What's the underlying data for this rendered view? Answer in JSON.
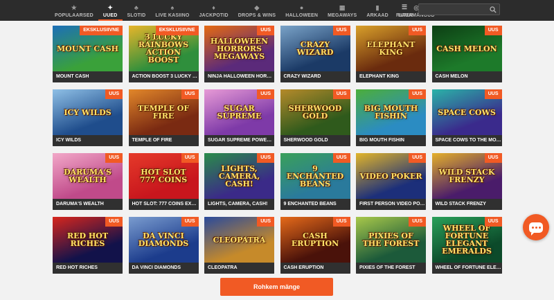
{
  "nav": {
    "items": [
      {
        "label": "POPULAARSED",
        "icon": "star-icon",
        "glyph": "★",
        "active": false
      },
      {
        "label": "UUED",
        "icon": "sparkle-icon",
        "glyph": "✦",
        "active": true
      },
      {
        "label": "SLOTID",
        "icon": "cherry-icon",
        "glyph": "♣",
        "active": false
      },
      {
        "label": "LIVE KASIINO",
        "icon": "live-dealer-icon",
        "glyph": "♠",
        "active": false
      },
      {
        "label": "JACKPOTID",
        "icon": "jackpot-icon",
        "glyph": "♦",
        "active": false
      },
      {
        "label": "DROPS & WINS",
        "icon": "drops-icon",
        "glyph": "◆",
        "active": false
      },
      {
        "label": "HALLOWEEN",
        "icon": "pumpkin-icon",
        "glyph": "●",
        "active": false
      },
      {
        "label": "MEGAWAYS",
        "icon": "megaways-icon",
        "glyph": "▦",
        "active": false
      },
      {
        "label": "ARKAAD",
        "icon": "arcade-icon",
        "glyph": "▮",
        "active": false
      },
      {
        "label": "LAUAMÄNGUD",
        "icon": "table-games-icon",
        "glyph": "◎",
        "active": false
      }
    ],
    "filter_label": "FILTER",
    "filter_icon": "filter-icon",
    "search_placeholder": "",
    "search_icon": "search-icon"
  },
  "games": [
    {
      "name": "MOUNT CASH",
      "badge": "EKSKLUSIIVNE",
      "art": "MOUNT CASH",
      "bg": "#3aa13a",
      "bg2": "#1c6fb8"
    },
    {
      "name": "ACTION BOOST 3 LUCKY RA...",
      "badge": "EKSKLUSIIVNE",
      "art": "3 LUCKY RAINBOWS ACTION BOOST",
      "bg": "#2f8f3c",
      "bg2": "#e7b52a"
    },
    {
      "name": "NINJA HALLOWEEN HORRO...",
      "badge": "UUS",
      "art": "HALLOWEEN HORRORS MEGAWAYS",
      "bg": "#5b2a7a",
      "bg2": "#e56a12"
    },
    {
      "name": "CRAZY WIZARD",
      "badge": "UUS",
      "art": "CRAZY WIZARD",
      "bg": "#1b3a66",
      "bg2": "#7aa3c8"
    },
    {
      "name": "ELEPHANT KING",
      "badge": "UUS",
      "art": "ELEPHANT KING",
      "bg": "#6a2b0e",
      "bg2": "#d9a02a"
    },
    {
      "name": "CASH MELON",
      "badge": "UUS",
      "art": "CASH MELON",
      "bg": "#1d7a2a",
      "bg2": "#0d3f14"
    },
    {
      "name": "ICY WILDS",
      "badge": "UUS",
      "art": "ICY WILDS",
      "bg": "#1f4d8c",
      "bg2": "#8fc0e6"
    },
    {
      "name": "TEMPLE OF FIRE",
      "badge": "UUS",
      "art": "TEMPLE OF FIRE",
      "bg": "#7a2a12",
      "bg2": "#e2872a"
    },
    {
      "name": "SUGAR SUPREME POWERN...",
      "badge": "UUS",
      "art": "SUGAR SUPREME",
      "bg": "#7e3aa8",
      "bg2": "#e79ad6"
    },
    {
      "name": "SHERWOOD GOLD",
      "badge": "UUS",
      "art": "SHERWOOD GOLD",
      "bg": "#2f5a1c",
      "bg2": "#b58a2a"
    },
    {
      "name": "BIG MOUTH FISHIN",
      "badge": "UUS",
      "art": "BIG MOUTH FISHIN",
      "bg": "#2b8cc2",
      "bg2": "#4cae3a"
    },
    {
      "name": "SPACE COWS TO THE MOO'N",
      "badge": "UUS",
      "art": "SPACE COWS",
      "bg": "#3a2a8c",
      "bg2": "#2bb3a8"
    },
    {
      "name": "DARUMA'S WEALTH",
      "badge": "UUS",
      "art": "DARUMA'S WEALTH",
      "bg": "#c04a8a",
      "bg2": "#f2a8c8"
    },
    {
      "name": "HOT SLOT: 777 COINS EXTR...",
      "badge": "UUS",
      "art": "HOT SLOT 777 COINS",
      "bg": "#c8161d",
      "bg2": "#e53a2a"
    },
    {
      "name": "LIGHTS, CAMERA, CASH!",
      "badge": "UUS",
      "art": "LIGHTS, CAMERA, CASH!",
      "bg": "#3b2a88",
      "bg2": "#2a8c4a"
    },
    {
      "name": "9 ENCHANTED BEANS",
      "badge": "UUS",
      "art": "9 ENCHANTED BEANS",
      "bg": "#2a7a9c",
      "bg2": "#3aa05a"
    },
    {
      "name": "FIRST PERSON VIDEO POKER",
      "badge": "UUS",
      "art": "VIDEO POKER",
      "bg": "#1c2f7a",
      "bg2": "#e2b52a"
    },
    {
      "name": "WILD STACK FRENZY",
      "badge": "UUS",
      "art": "WILD STACK FRENZY",
      "bg": "#4a1c6a",
      "bg2": "#e5b02a"
    },
    {
      "name": "RED HOT RICHES",
      "badge": "UUS",
      "art": "RED HOT RICHES",
      "bg": "#12124a",
      "bg2": "#d8261d"
    },
    {
      "name": "DA VINCI DIAMONDS",
      "badge": "UUS",
      "art": "DA VINCI DIAMONDS",
      "bg": "#1c3c8c",
      "bg2": "#7a9ccf"
    },
    {
      "name": "CLEOPATRA",
      "badge": "UUS",
      "art": "CLEOPATRA",
      "bg": "#c68a2a",
      "bg2": "#2a4a9c"
    },
    {
      "name": "CASH ERUPTION",
      "badge": "UUS",
      "art": "CASH ERUPTION",
      "bg": "#4a120a",
      "bg2": "#e56a1a"
    },
    {
      "name": "PIXIES OF THE FOREST",
      "badge": "UUS",
      "art": "PIXIES OF THE FOREST",
      "bg": "#1c5a3a",
      "bg2": "#a8c84a"
    },
    {
      "name": "WHEEL OF FORTUNE ELEG...",
      "badge": "UUS",
      "art": "WHEEL OF FORTUNE ELEGANT EMERALDS",
      "bg": "#0c4a2a",
      "bg2": "#2aa05a"
    }
  ],
  "more_button": "Rohkem mänge",
  "chat_icon": "chat-icon",
  "colors": {
    "accent": "#f15a24",
    "topbar": "#2c2c2c",
    "caption": "#303030",
    "page": "#f2f2f2"
  }
}
